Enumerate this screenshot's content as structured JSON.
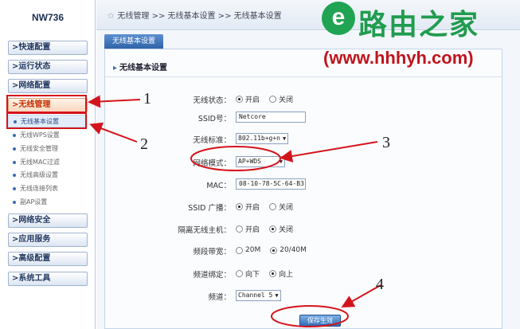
{
  "app": {
    "model": "NW736"
  },
  "breadcrumb": "无线管理 >> 无线基本设置 >> 无线基本设置",
  "sidebar": {
    "menus": [
      {
        "label": ">快速配置"
      },
      {
        "label": ">运行状态"
      },
      {
        "label": ">网络配置"
      },
      {
        "label": ">无线管理"
      },
      {
        "label": ">网络安全"
      },
      {
        "label": ">应用服务"
      },
      {
        "label": ">高级配置"
      },
      {
        "label": ">系统工具"
      }
    ],
    "submenus": [
      {
        "label": "无线基本设置"
      },
      {
        "label": "无线WPS设置"
      },
      {
        "label": "无线安全管理"
      },
      {
        "label": "无线MAC过滤"
      },
      {
        "label": "无线高级设置"
      },
      {
        "label": "无线连接列表"
      },
      {
        "label": "副AP设置"
      }
    ]
  },
  "tab": "无线基本设置",
  "panel_title": "无线基本设置",
  "form": {
    "wireless_status": {
      "label": "无线状态：",
      "on": "开启",
      "off": "关闭",
      "selected": "on"
    },
    "ssid": {
      "label": "SSID号：",
      "value": "Netcore"
    },
    "standard": {
      "label": "无线标准：",
      "value": "802.11b+g+n"
    },
    "mode": {
      "label": "网络模式：",
      "value": "AP+WDS"
    },
    "mac": {
      "label": "MAC：",
      "value": "08-10-78-5C-64-B3"
    },
    "ssid_broadcast": {
      "label": "SSID 广播：",
      "on": "开启",
      "off": "关闭",
      "selected": "on"
    },
    "isolation": {
      "label": "隔离无线主机：",
      "on": "开启",
      "off": "关闭",
      "selected": "off"
    },
    "bandwidth": {
      "label": "频段带宽：",
      "opt1": "20M",
      "opt2": "20/40M",
      "selected": "opt2"
    },
    "channel_bind": {
      "label": "频道绑定：",
      "down": "向下",
      "up": "向上",
      "selected": "up"
    },
    "channel": {
      "label": "频道：",
      "value": "Channel 5"
    },
    "save_label": "保存生效"
  },
  "watermark": {
    "title": "路由之家",
    "url": "(www.hhhyh.com)"
  },
  "annotations": [
    "1",
    "2",
    "3",
    "4"
  ],
  "colors": {
    "annotation": "#d4141c",
    "brand_green": "#209c4e",
    "brand_red": "#c0141c"
  }
}
